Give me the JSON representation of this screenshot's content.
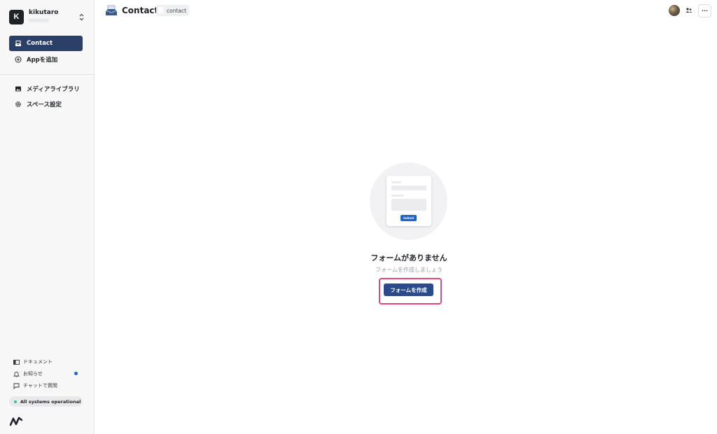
{
  "space": {
    "avatar_letter": "K",
    "name": "kikutaro",
    "sub": "xxxxxxxx"
  },
  "sidebar": {
    "items": [
      {
        "label": "Contact",
        "icon": "inbox-icon",
        "active": true
      },
      {
        "label": "Appを追加",
        "icon": "plus-circle-icon",
        "active": false
      },
      {
        "label": "メディアライブラリ",
        "icon": "image-icon",
        "active": false
      },
      {
        "label": "スペース設定",
        "icon": "gear-icon",
        "active": false
      }
    ],
    "footer": [
      {
        "label": "ドキュメント",
        "icon": "book-icon"
      },
      {
        "label": "お知らせ",
        "icon": "bell-icon"
      },
      {
        "label": "チャットで質問",
        "icon": "chat-icon"
      }
    ],
    "status": "All systems operational"
  },
  "header": {
    "title": "Contact",
    "endpoint": "contact"
  },
  "empty_state": {
    "submit_label": "Submit",
    "title": "フォームがありません",
    "subtitle": "フォームを作成しましょう",
    "button_label": "フォームを作成"
  },
  "colors": {
    "active_nav": "#2c4067",
    "primary_button": "#2a4a8a",
    "highlight": "#e5457a",
    "status_dot": "#22c5a0",
    "notify_dot": "#1b63d8"
  }
}
